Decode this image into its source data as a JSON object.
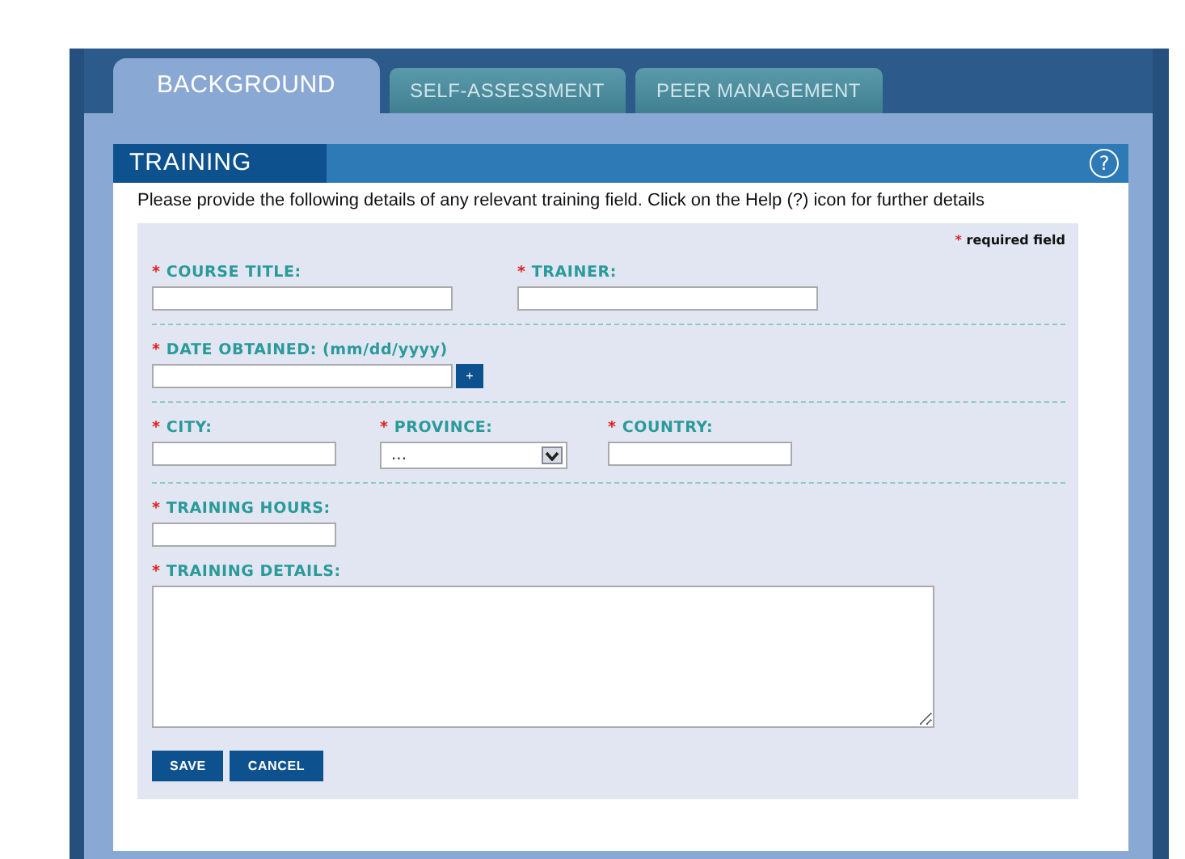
{
  "tabs": [
    {
      "label": "BACKGROUND",
      "selected": true
    },
    {
      "label": "SELF-ASSESSMENT",
      "selected": false
    },
    {
      "label": "PEER MANAGEMENT",
      "selected": false
    }
  ],
  "section": {
    "title": "TRAINING",
    "help_icon": "?"
  },
  "instructions": "Please provide the following details of any relevant training field.  Click on the Help (?) icon for further details",
  "required_note": {
    "mark": "*",
    "text": "required field"
  },
  "rows": [
    {
      "fields": [
        {
          "kind": "text",
          "mark": "*",
          "label": "COURSE TITLE:"
        },
        {
          "kind": "text",
          "mark": "*",
          "label": "TRAINER:"
        }
      ],
      "divider": true
    },
    {
      "fields": [
        {
          "kind": "date",
          "mark": "*",
          "label": "DATE OBTAINED: (mm/dd/yyyy)",
          "button": "+"
        }
      ],
      "divider": true
    },
    {
      "fields": [
        {
          "kind": "text",
          "mark": "*",
          "label": "CITY:"
        },
        {
          "kind": "select",
          "mark": "*",
          "label": "PROVINCE:",
          "value": "..."
        },
        {
          "kind": "text",
          "mark": "*",
          "label": "COUNTRY:"
        }
      ],
      "divider": true
    },
    {
      "fields": [
        {
          "kind": "text",
          "mark": "*",
          "label": "TRAINING HOURS:"
        }
      ],
      "divider": false
    },
    {
      "fields": [
        {
          "kind": "textarea",
          "mark": "*",
          "label": "TRAINING DETAILS:"
        }
      ],
      "divider": false
    }
  ],
  "buttons": [
    "SAVE",
    "CANCEL"
  ]
}
